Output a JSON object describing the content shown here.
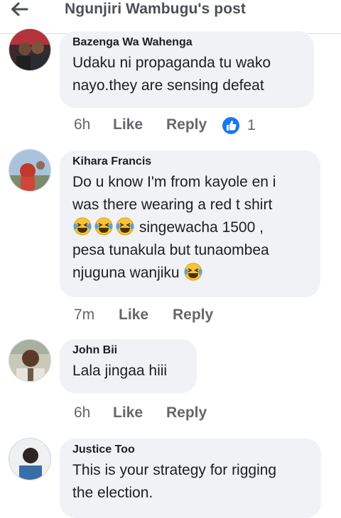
{
  "header": {
    "title": "Ngunjiri Wambugu's post"
  },
  "comments": [
    {
      "author": "Bazenga Wa Wahenga",
      "lines": [
        "Udaku ni propaganda tu wako",
        "nayo.they are sensing defeat"
      ],
      "time": "6h",
      "like": "Like",
      "reply": "Reply",
      "reaction_icon": "thumbs-up-icon",
      "reaction_count": "1"
    },
    {
      "author": "Kihara Francis",
      "line1": "Do u know I'm from kayole en i",
      "line2": "was there wearing a red t shirt",
      "line3_after_emojis": " singewacha 1500 ,",
      "line4": "pesa tunakula but tunaombea",
      "line5": "njuguna wanjiku ",
      "emoji_icon": "laughing-tears-emoji",
      "time": "7m",
      "like": "Like",
      "reply": "Reply"
    },
    {
      "author": "John Bii",
      "lines": [
        "Lala jingaa hiii"
      ],
      "time": "6h",
      "like": "Like",
      "reply": "Reply"
    },
    {
      "author": "Justice Too",
      "lines": [
        "This is your strategy for rigging",
        "the election."
      ]
    }
  ],
  "colors": {
    "bubble": "#f0f2f5",
    "meta_text": "#65676b",
    "like_blue": "#1877f2"
  }
}
